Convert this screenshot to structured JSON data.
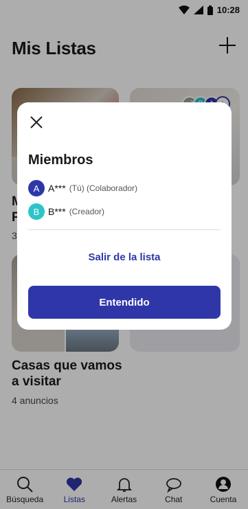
{
  "status_bar": {
    "time": "10:28"
  },
  "page": {
    "title": "Mis Listas"
  },
  "lists": [
    {
      "name": "M\nF",
      "count": "3"
    },
    {
      "name": "",
      "avatars_extra": "+3",
      "avatar_b": "B",
      "avatar_a": "A",
      "avatar_plus": "+"
    },
    {
      "name": "Casas que vamos a visitar",
      "count": "4 anuncios"
    }
  ],
  "modal": {
    "title": "Miembros",
    "members": [
      {
        "initial": "A",
        "name": "A***",
        "role": "(Tú) (Colaborador)",
        "color": "#2f37a8"
      },
      {
        "initial": "B",
        "name": "B***",
        "role": "(Creador)",
        "color": "#2bc4c9"
      }
    ],
    "leave_label": "Salir de la lista",
    "confirm_label": "Entendido"
  },
  "nav": [
    {
      "label": "Búsqueda",
      "icon": "search-icon"
    },
    {
      "label": "Listas",
      "icon": "heart-icon",
      "active": true
    },
    {
      "label": "Alertas",
      "icon": "bell-icon"
    },
    {
      "label": "Chat",
      "icon": "chat-icon"
    },
    {
      "label": "Cuenta",
      "icon": "account-icon"
    }
  ],
  "colors": {
    "accent": "#2f37a8",
    "teal": "#2bc4c9"
  }
}
